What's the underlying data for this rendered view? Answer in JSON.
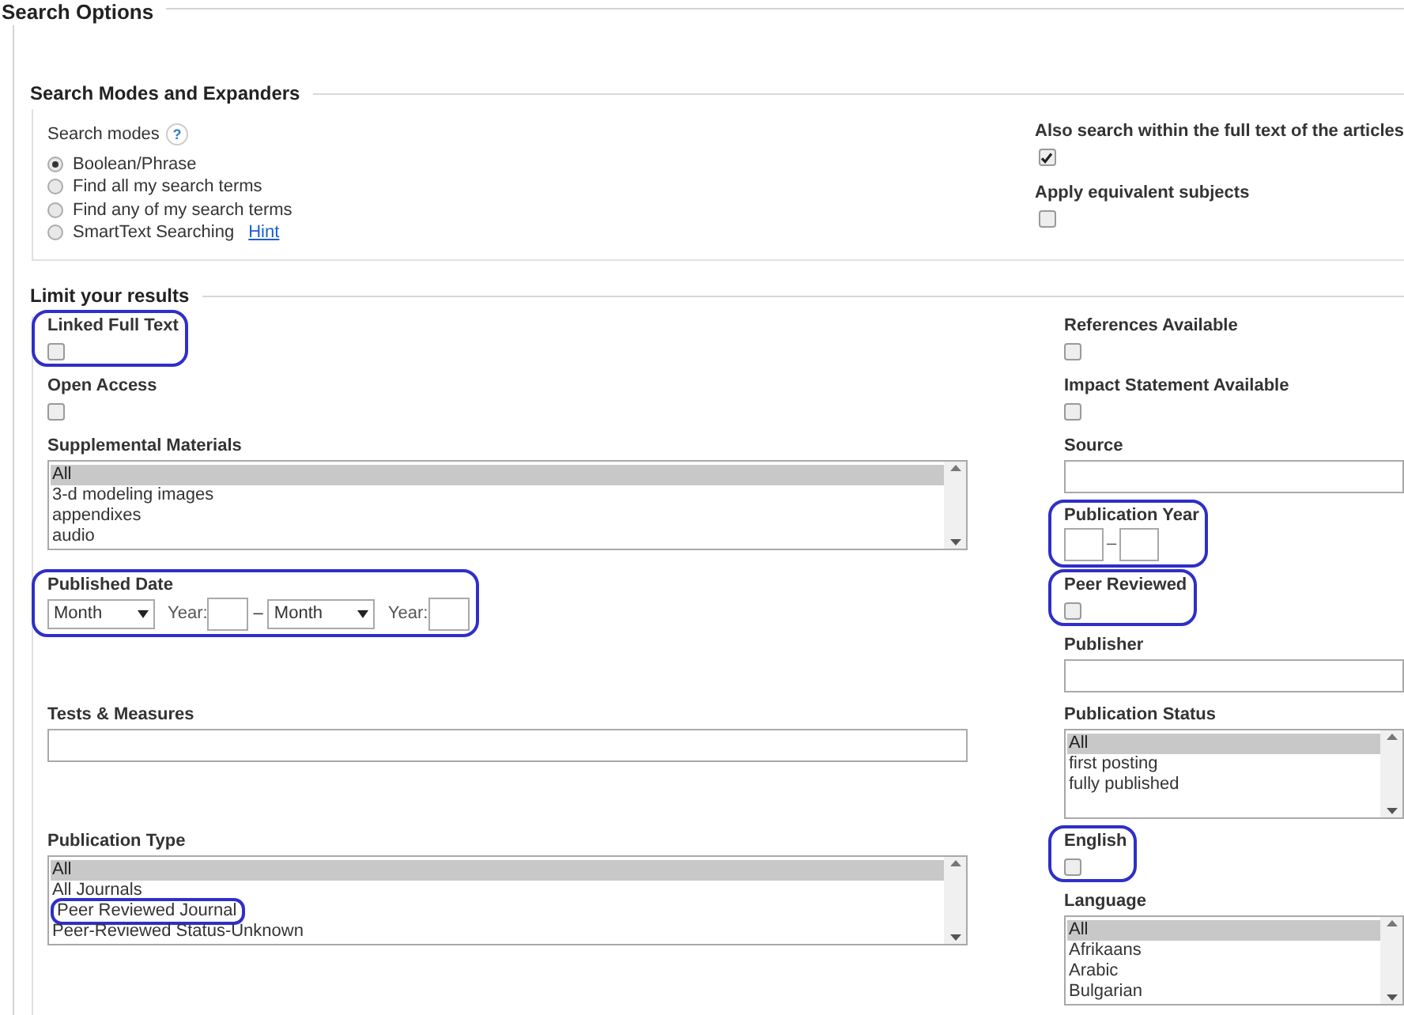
{
  "title": "Search Options",
  "search_modes_section": {
    "title": "Search Modes and Expanders",
    "modes_label": "Search modes",
    "help": "?",
    "modes": [
      {
        "label": "Boolean/Phrase",
        "selected": true
      },
      {
        "label": "Find all my search terms",
        "selected": false
      },
      {
        "label": "Find any of my search terms",
        "selected": false
      },
      {
        "label": "SmartText Searching",
        "selected": false,
        "link": "Hint"
      }
    ],
    "expanders": [
      {
        "label": "Also search within the full text of the articles",
        "checked": true
      },
      {
        "label": "Apply equivalent subjects",
        "checked": false
      }
    ]
  },
  "limits_section": {
    "title": "Limit your results",
    "left": [
      {
        "kind": "checkbox",
        "label": "Linked Full Text",
        "checked": false,
        "highlighted": true
      },
      {
        "kind": "checkbox",
        "label": "Open Access",
        "checked": false,
        "highlighted": false
      },
      {
        "kind": "listbox",
        "label": "Supplemental Materials",
        "highlighted": false,
        "options": [
          {
            "text": "All",
            "selected": true,
            "highlighted": false
          },
          {
            "text": "3-d modeling images",
            "selected": false,
            "highlighted": false
          },
          {
            "text": "appendixes",
            "selected": false,
            "highlighted": false
          },
          {
            "text": "audio",
            "selected": false,
            "highlighted": false
          }
        ]
      },
      {
        "kind": "date_range",
        "label": "Published Date",
        "highlighted": true,
        "parts": [
          {
            "kind": "select",
            "value": "Month"
          },
          {
            "kind": "label",
            "text": "Year:"
          },
          {
            "kind": "input"
          },
          {
            "kind": "separator",
            "text": "–"
          },
          {
            "kind": "select",
            "value": "Month"
          },
          {
            "kind": "label",
            "text": "Year:"
          },
          {
            "kind": "input"
          }
        ]
      },
      {
        "kind": "text",
        "label": "Tests & Measures",
        "highlighted": false
      },
      {
        "kind": "listbox",
        "label": "Publication Type",
        "highlighted": false,
        "options": [
          {
            "text": "All",
            "selected": true,
            "highlighted": false
          },
          {
            "text": "All Journals",
            "selected": false,
            "highlighted": false
          },
          {
            "text": "Peer Reviewed Journal",
            "selected": false,
            "highlighted": true
          },
          {
            "text": "Peer-Reviewed Status-Unknown",
            "selected": false,
            "highlighted": false
          }
        ]
      }
    ],
    "right": [
      {
        "kind": "checkbox",
        "label": "References Available",
        "checked": false,
        "highlighted": false
      },
      {
        "kind": "checkbox",
        "label": "Impact Statement Available",
        "checked": false,
        "highlighted": false
      },
      {
        "kind": "text",
        "label": "Source",
        "highlighted": false
      },
      {
        "kind": "year_range",
        "label": "Publication Year",
        "highlighted": true,
        "separator": "–"
      },
      {
        "kind": "checkbox",
        "label": "Peer Reviewed",
        "checked": false,
        "highlighted": true
      },
      {
        "kind": "text",
        "label": "Publisher",
        "highlighted": false
      },
      {
        "kind": "listbox",
        "label": "Publication Status",
        "highlighted": false,
        "options": [
          {
            "text": "All",
            "selected": true,
            "highlighted": false
          },
          {
            "text": "first posting",
            "selected": false,
            "highlighted": false
          },
          {
            "text": "fully published",
            "selected": false,
            "highlighted": false
          }
        ]
      },
      {
        "kind": "checkbox",
        "label": "English",
        "checked": false,
        "highlighted": true
      },
      {
        "kind": "listbox",
        "label": "Language",
        "highlighted": false,
        "options": [
          {
            "text": "All",
            "selected": true,
            "highlighted": false
          },
          {
            "text": "Afrikaans",
            "selected": false,
            "highlighted": false
          },
          {
            "text": "Arabic",
            "selected": false,
            "highlighted": false
          },
          {
            "text": "Bulgarian",
            "selected": false,
            "highlighted": false
          }
        ]
      }
    ]
  }
}
